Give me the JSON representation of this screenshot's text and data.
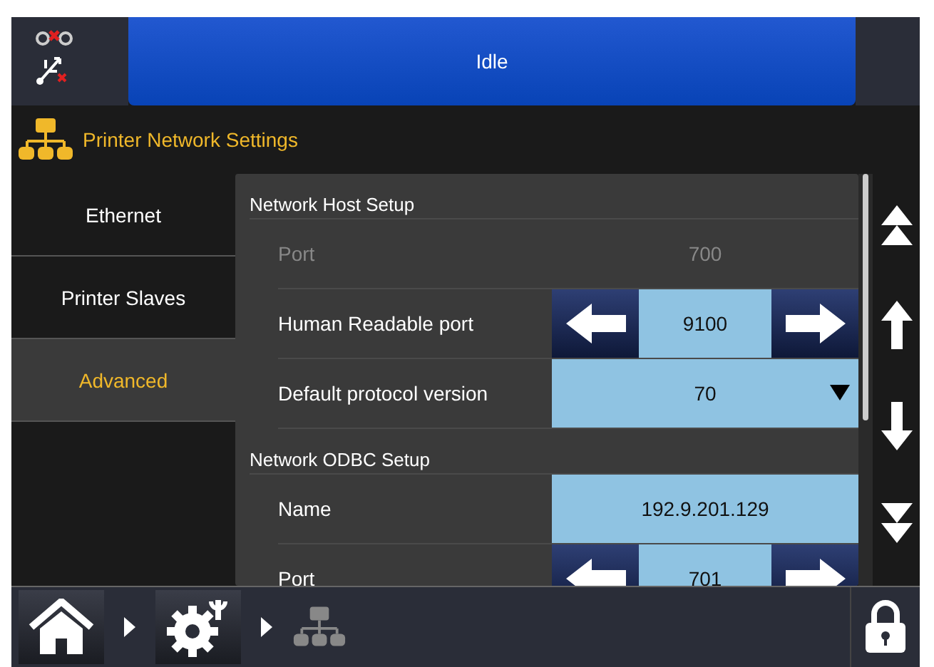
{
  "status": {
    "text": "Idle"
  },
  "header": {
    "title": "Printer Network Settings"
  },
  "tabs": [
    {
      "label": "Ethernet",
      "selected": false
    },
    {
      "label": "Printer Slaves",
      "selected": false
    },
    {
      "label": "Advanced",
      "selected": true
    }
  ],
  "sections": [
    {
      "title": "Network Host Setup",
      "rows": [
        {
          "label": "Port",
          "kind": "static",
          "value": "700",
          "disabled": true
        },
        {
          "label": "Human Readable port",
          "kind": "stepper",
          "value": "9100",
          "disabled": false
        },
        {
          "label": "Default protocol version",
          "kind": "dropdown",
          "value": "70",
          "disabled": false
        }
      ]
    },
    {
      "title": "Network ODBC Setup",
      "rows": [
        {
          "label": "Name",
          "kind": "text",
          "value": "192.9.201.129",
          "disabled": false
        },
        {
          "label": "Port",
          "kind": "stepper",
          "value": "701",
          "disabled": false
        }
      ]
    }
  ]
}
